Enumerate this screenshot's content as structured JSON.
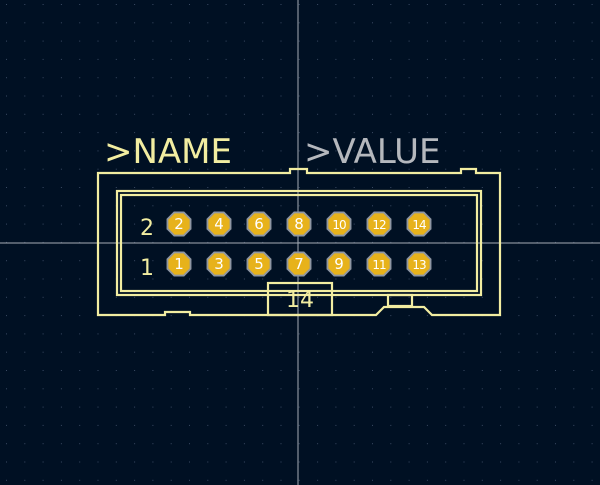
{
  "colors": {
    "background": "#001023",
    "grid_dot": "#3a4a63",
    "crosshair": "#a6adb6",
    "silkscreen": "#f2eda1",
    "value_text": "#b5b8bd",
    "pad_ring": "#8e96a3",
    "pad_copper": "#e7b21b",
    "pad_number": "#ffffff"
  },
  "labels": {
    "name": ">NAME",
    "value": ">VALUE",
    "row_top": "2",
    "row_bottom": "1",
    "pin_count": "14"
  },
  "pads": {
    "top_row": [
      "2",
      "4",
      "6",
      "8",
      "10",
      "12",
      "14"
    ],
    "bottom_row": [
      "1",
      "3",
      "5",
      "7",
      "9",
      "11",
      "13"
    ]
  }
}
